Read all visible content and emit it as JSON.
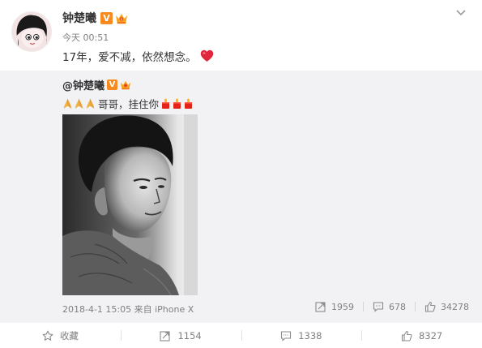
{
  "post": {
    "author": "钟楚曦",
    "time": "今天 00:51",
    "text": "17年，爱不减，依然想念。",
    "icons": {
      "avatar": "cartoon-avatar",
      "verified": "verified-v-badge",
      "member": "crown-badge",
      "heart": "red-heart"
    }
  },
  "repost": {
    "author": "@钟楚曦",
    "text": "哥哥，挂住你",
    "meta": "2018-4-1 15:05 来自 iPhone X",
    "stats": {
      "forward": "1959",
      "comment": "678",
      "like": "34278"
    }
  },
  "actions": {
    "collect": "收藏",
    "forward": "1154",
    "comment": "1338",
    "like": "8327"
  },
  "colors": {
    "accent": "#f78b1f",
    "gray": "#808080",
    "repost_bg": "#f2f2f5",
    "heart": "#e0263a"
  }
}
